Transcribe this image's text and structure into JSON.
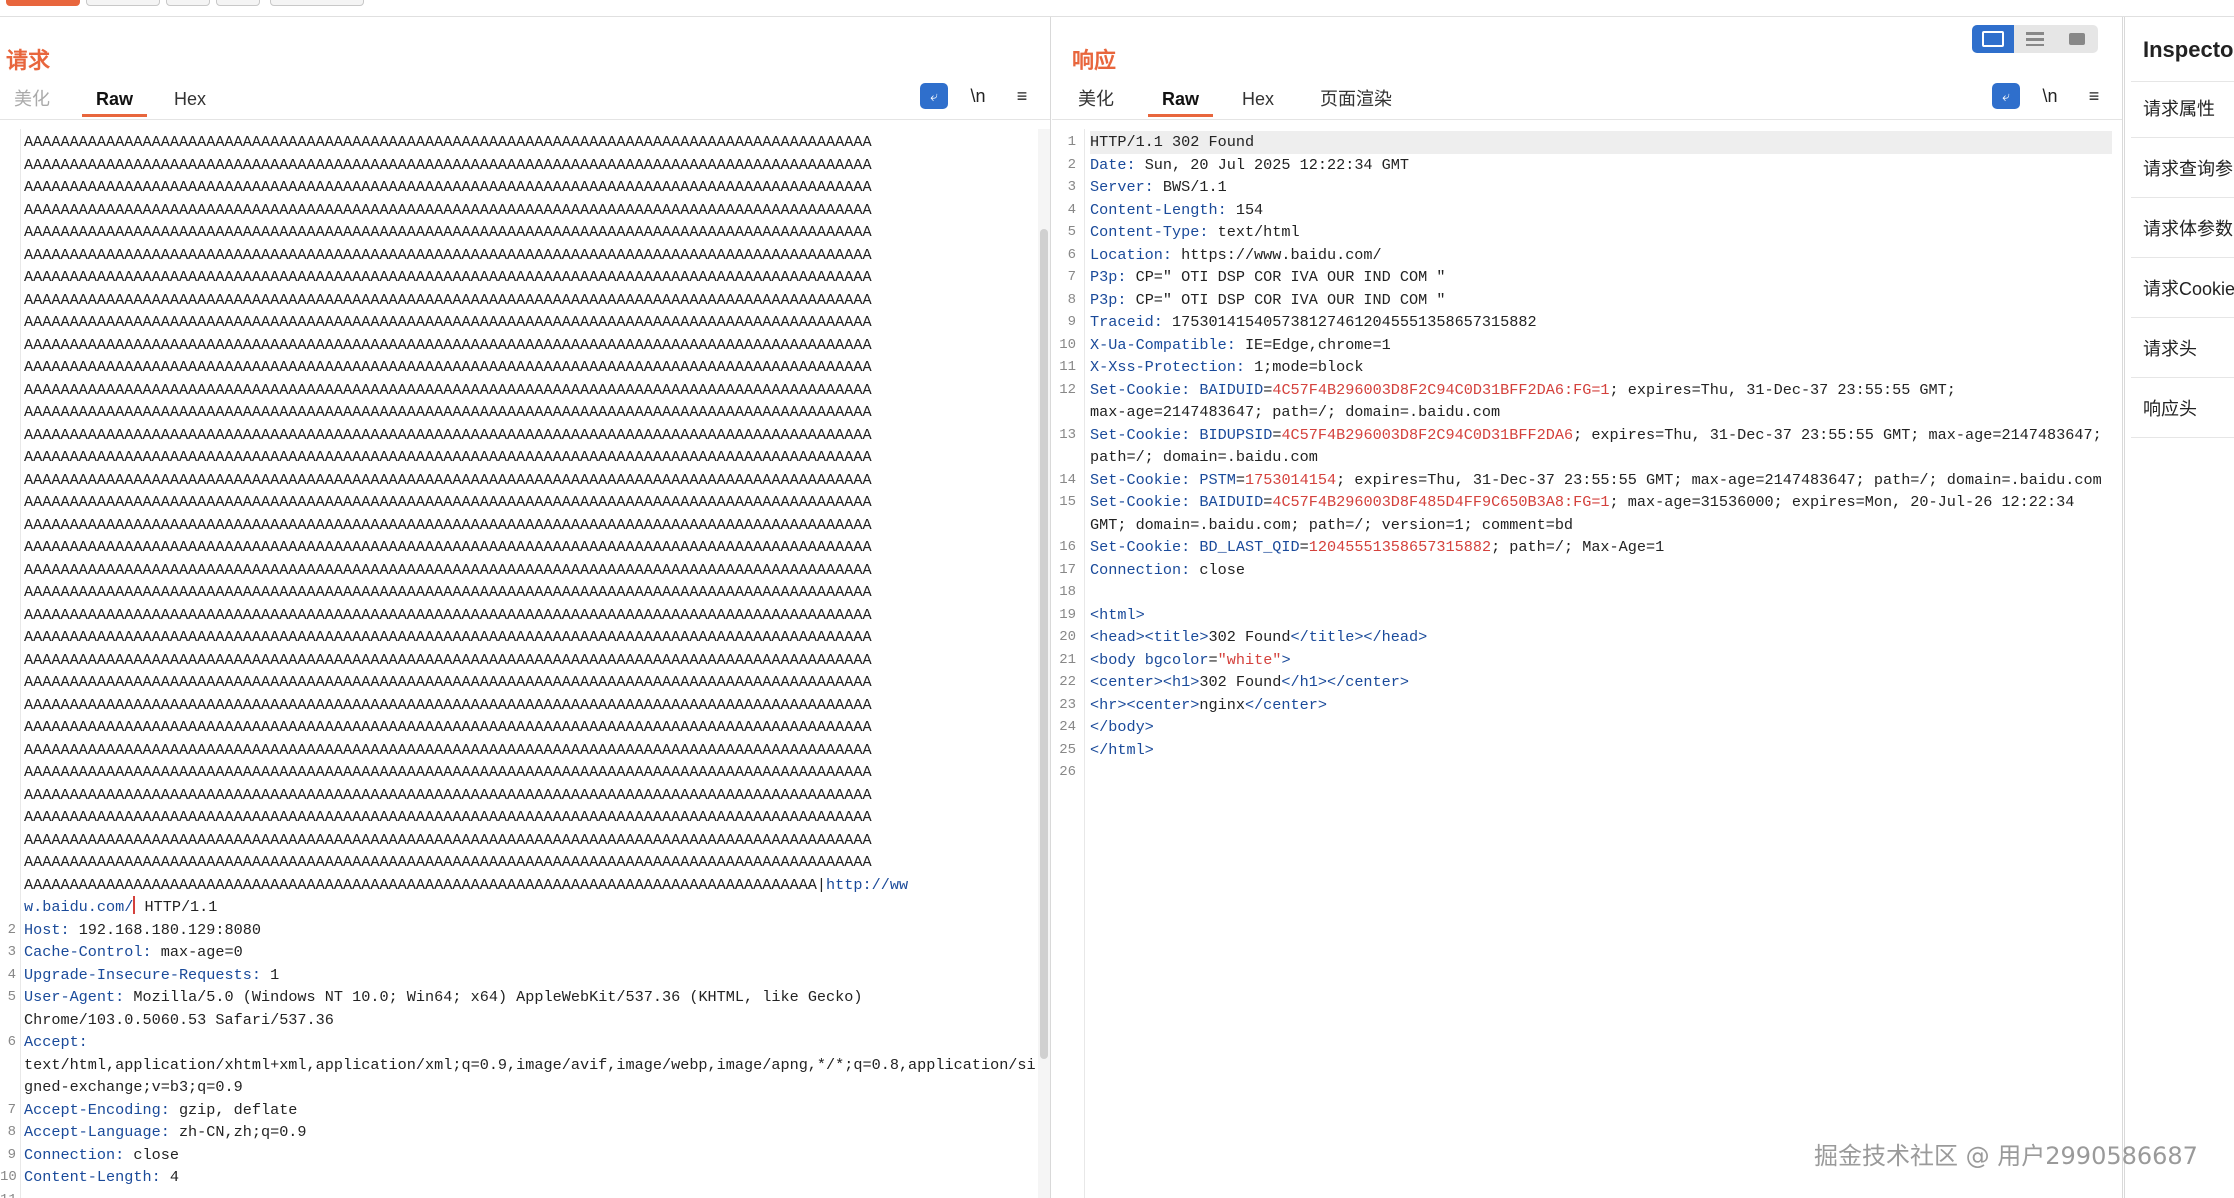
{
  "request": {
    "title": "请求",
    "tabs": [
      "美化",
      "Raw",
      "Hex"
    ],
    "active_tab": "Raw",
    "tools": [
      "\\n",
      "≡"
    ],
    "lines": [
      {
        "n": "",
        "t": "AAAAAAAAAAAAAAAAAAAAAAAAAAAAAAAAAAAAAAAAAAAAAAAAAAAAAAAAAAAAAAAAAAAAAAAAAAAAAAAAAAAAAAAAAAAAA"
      },
      {
        "n": "",
        "t": "AAAAAAAAAAAAAAAAAAAAAAAAAAAAAAAAAAAAAAAAAAAAAAAAAAAAAAAAAAAAAAAAAAAAAAAAAAAAAAAAAAAAAAAAAAAAA"
      },
      {
        "n": "",
        "t": "AAAAAAAAAAAAAAAAAAAAAAAAAAAAAAAAAAAAAAAAAAAAAAAAAAAAAAAAAAAAAAAAAAAAAAAAAAAAAAAAAAAAAAAAAAAAA"
      },
      {
        "n": "",
        "t": "AAAAAAAAAAAAAAAAAAAAAAAAAAAAAAAAAAAAAAAAAAAAAAAAAAAAAAAAAAAAAAAAAAAAAAAAAAAAAAAAAAAAAAAAAAAAA"
      },
      {
        "n": "",
        "t": "AAAAAAAAAAAAAAAAAAAAAAAAAAAAAAAAAAAAAAAAAAAAAAAAAAAAAAAAAAAAAAAAAAAAAAAAAAAAAAAAAAAAAAAAAAAAA"
      },
      {
        "n": "",
        "t": "AAAAAAAAAAAAAAAAAAAAAAAAAAAAAAAAAAAAAAAAAAAAAAAAAAAAAAAAAAAAAAAAAAAAAAAAAAAAAAAAAAAAAAAAAAAAA"
      },
      {
        "n": "",
        "t": "AAAAAAAAAAAAAAAAAAAAAAAAAAAAAAAAAAAAAAAAAAAAAAAAAAAAAAAAAAAAAAAAAAAAAAAAAAAAAAAAAAAAAAAAAAAAA"
      },
      {
        "n": "",
        "t": "AAAAAAAAAAAAAAAAAAAAAAAAAAAAAAAAAAAAAAAAAAAAAAAAAAAAAAAAAAAAAAAAAAAAAAAAAAAAAAAAAAAAAAAAAAAAA"
      },
      {
        "n": "",
        "t": "AAAAAAAAAAAAAAAAAAAAAAAAAAAAAAAAAAAAAAAAAAAAAAAAAAAAAAAAAAAAAAAAAAAAAAAAAAAAAAAAAAAAAAAAAAAAA"
      },
      {
        "n": "",
        "t": "AAAAAAAAAAAAAAAAAAAAAAAAAAAAAAAAAAAAAAAAAAAAAAAAAAAAAAAAAAAAAAAAAAAAAAAAAAAAAAAAAAAAAAAAAAAAA"
      },
      {
        "n": "",
        "t": "AAAAAAAAAAAAAAAAAAAAAAAAAAAAAAAAAAAAAAAAAAAAAAAAAAAAAAAAAAAAAAAAAAAAAAAAAAAAAAAAAAAAAAAAAAAAA"
      },
      {
        "n": "",
        "t": "AAAAAAAAAAAAAAAAAAAAAAAAAAAAAAAAAAAAAAAAAAAAAAAAAAAAAAAAAAAAAAAAAAAAAAAAAAAAAAAAAAAAAAAAAAAAA"
      },
      {
        "n": "",
        "t": "AAAAAAAAAAAAAAAAAAAAAAAAAAAAAAAAAAAAAAAAAAAAAAAAAAAAAAAAAAAAAAAAAAAAAAAAAAAAAAAAAAAAAAAAAAAAA"
      },
      {
        "n": "",
        "t": "AAAAAAAAAAAAAAAAAAAAAAAAAAAAAAAAAAAAAAAAAAAAAAAAAAAAAAAAAAAAAAAAAAAAAAAAAAAAAAAAAAAAAAAAAAAAA"
      },
      {
        "n": "",
        "t": "AAAAAAAAAAAAAAAAAAAAAAAAAAAAAAAAAAAAAAAAAAAAAAAAAAAAAAAAAAAAAAAAAAAAAAAAAAAAAAAAAAAAAAAAAAAAA"
      },
      {
        "n": "",
        "t": "AAAAAAAAAAAAAAAAAAAAAAAAAAAAAAAAAAAAAAAAAAAAAAAAAAAAAAAAAAAAAAAAAAAAAAAAAAAAAAAAAAAAAAAAAAAAA"
      },
      {
        "n": "",
        "t": "AAAAAAAAAAAAAAAAAAAAAAAAAAAAAAAAAAAAAAAAAAAAAAAAAAAAAAAAAAAAAAAAAAAAAAAAAAAAAAAAAAAAAAAAAAAAA"
      },
      {
        "n": "",
        "t": "AAAAAAAAAAAAAAAAAAAAAAAAAAAAAAAAAAAAAAAAAAAAAAAAAAAAAAAAAAAAAAAAAAAAAAAAAAAAAAAAAAAAAAAAAAAAA"
      },
      {
        "n": "",
        "t": "AAAAAAAAAAAAAAAAAAAAAAAAAAAAAAAAAAAAAAAAAAAAAAAAAAAAAAAAAAAAAAAAAAAAAAAAAAAAAAAAAAAAAAAAAAAAA"
      },
      {
        "n": "",
        "t": "AAAAAAAAAAAAAAAAAAAAAAAAAAAAAAAAAAAAAAAAAAAAAAAAAAAAAAAAAAAAAAAAAAAAAAAAAAAAAAAAAAAAAAAAAAAAA"
      },
      {
        "n": "",
        "t": "AAAAAAAAAAAAAAAAAAAAAAAAAAAAAAAAAAAAAAAAAAAAAAAAAAAAAAAAAAAAAAAAAAAAAAAAAAAAAAAAAAAAAAAAAAAAA"
      },
      {
        "n": "",
        "t": "AAAAAAAAAAAAAAAAAAAAAAAAAAAAAAAAAAAAAAAAAAAAAAAAAAAAAAAAAAAAAAAAAAAAAAAAAAAAAAAAAAAAAAAAAAAAA"
      },
      {
        "n": "",
        "t": "AAAAAAAAAAAAAAAAAAAAAAAAAAAAAAAAAAAAAAAAAAAAAAAAAAAAAAAAAAAAAAAAAAAAAAAAAAAAAAAAAAAAAAAAAAAAA"
      },
      {
        "n": "",
        "t": "AAAAAAAAAAAAAAAAAAAAAAAAAAAAAAAAAAAAAAAAAAAAAAAAAAAAAAAAAAAAAAAAAAAAAAAAAAAAAAAAAAAAAAAAAAAAA"
      },
      {
        "n": "",
        "t": "AAAAAAAAAAAAAAAAAAAAAAAAAAAAAAAAAAAAAAAAAAAAAAAAAAAAAAAAAAAAAAAAAAAAAAAAAAAAAAAAAAAAAAAAAAAAA"
      },
      {
        "n": "",
        "t": "AAAAAAAAAAAAAAAAAAAAAAAAAAAAAAAAAAAAAAAAAAAAAAAAAAAAAAAAAAAAAAAAAAAAAAAAAAAAAAAAAAAAAAAAAAAAA"
      },
      {
        "n": "",
        "t": "AAAAAAAAAAAAAAAAAAAAAAAAAAAAAAAAAAAAAAAAAAAAAAAAAAAAAAAAAAAAAAAAAAAAAAAAAAAAAAAAAAAAAAAAAAAAA"
      },
      {
        "n": "",
        "t": "AAAAAAAAAAAAAAAAAAAAAAAAAAAAAAAAAAAAAAAAAAAAAAAAAAAAAAAAAAAAAAAAAAAAAAAAAAAAAAAAAAAAAAAAAAAAA"
      },
      {
        "n": "",
        "t": "AAAAAAAAAAAAAAAAAAAAAAAAAAAAAAAAAAAAAAAAAAAAAAAAAAAAAAAAAAAAAAAAAAAAAAAAAAAAAAAAAAAAAAAAAAAAA"
      },
      {
        "n": "",
        "t": "AAAAAAAAAAAAAAAAAAAAAAAAAAAAAAAAAAAAAAAAAAAAAAAAAAAAAAAAAAAAAAAAAAAAAAAAAAAAAAAAAAAAAAAAAAAAA"
      },
      {
        "n": "",
        "t": "AAAAAAAAAAAAAAAAAAAAAAAAAAAAAAAAAAAAAAAAAAAAAAAAAAAAAAAAAAAAAAAAAAAAAAAAAAAAAAAAAAAAAAAAAAAAA"
      },
      {
        "n": "",
        "t": "AAAAAAAAAAAAAAAAAAAAAAAAAAAAAAAAAAAAAAAAAAAAAAAAAAAAAAAAAAAAAAAAAAAAAAAAAAAAAAAAAAAAAAAAAAAAA"
      },
      {
        "n": "",
        "t": "AAAAAAAAAAAAAAAAAAAAAAAAAAAAAAAAAAAAAAAAAAAAAAAAAAAAAAAAAAAAAAAAAAAAAAAAAAAAAAAAAAAAAAAAAAAAA"
      },
      {
        "n": "",
        "t": "AAAAAAAAAAAAAAAAAAAAAAAAAAAAAAAAAAAAAAAAAAAAAAAAAAAAAAAAAAAAAAAAAAAAAAAAAAAAAAAAAAAAAAA|",
        "tail": "http://ww"
      },
      {
        "n": "",
        "url": "w.baidu.com/",
        "t": " HTTP/1.1",
        "caret": true
      },
      {
        "n": "2",
        "k": "Host",
        "v": " 192.168.180.129:8080"
      },
      {
        "n": "3",
        "k": "Cache-Control",
        "v": " max-age=0"
      },
      {
        "n": "4",
        "k": "Upgrade-Insecure-Requests",
        "v": " 1"
      },
      {
        "n": "5",
        "k": "User-Agent",
        "v": " Mozilla/5.0 (Windows NT 10.0; Win64; x64) AppleWebKit/537.36 (KHTML, like Gecko)"
      },
      {
        "n": "",
        "t": "Chrome/103.0.5060.53 Safari/537.36"
      },
      {
        "n": "6",
        "k": "Accept",
        "v": ""
      },
      {
        "n": "",
        "t": "text/html,application/xhtml+xml,application/xml;q=0.9,image/avif,image/webp,image/apng,*/*;q=0.8,application/si"
      },
      {
        "n": "",
        "t": "gned-exchange;v=b3;q=0.9"
      },
      {
        "n": "7",
        "k": "Accept-Encoding",
        "v": " gzip, deflate"
      },
      {
        "n": "8",
        "k": "Accept-Language",
        "v": " zh-CN,zh;q=0.9"
      },
      {
        "n": "9",
        "k": "Connection",
        "v": " close"
      },
      {
        "n": "10",
        "k": "Content-Length",
        "v": " 4"
      },
      {
        "n": "11",
        "t": ""
      }
    ]
  },
  "response": {
    "title": "响应",
    "tabs": [
      "美化",
      "Raw",
      "Hex",
      "页面渲染"
    ],
    "active_tab": "Raw",
    "tools": [
      "\\n",
      "≡"
    ],
    "lines": [
      {
        "n": "1",
        "t": "HTTP/1.1 302 Found",
        "hl": true
      },
      {
        "n": "2",
        "k": "Date",
        "v": " Sun, 20 Jul 2025 12:22:34 GMT"
      },
      {
        "n": "3",
        "k": "Server",
        "v": " BWS/1.1"
      },
      {
        "n": "4",
        "k": "Content-Length",
        "v": " 154"
      },
      {
        "n": "5",
        "k": "Content-Type",
        "v": " text/html"
      },
      {
        "n": "6",
        "k": "Location",
        "v": " https://www.baidu.com/"
      },
      {
        "n": "7",
        "k": "P3p",
        "v": " CP=\" OTI DSP COR IVA OUR IND COM \""
      },
      {
        "n": "8",
        "k": "P3p",
        "v": " CP=\" OTI DSP COR IVA OUR IND COM \""
      },
      {
        "n": "9",
        "k": "Traceid",
        "v": " 1753014154057381274612045551358657315882"
      },
      {
        "n": "10",
        "k": "X-Ua-Compatible",
        "v": " IE=Edge,chrome=1"
      },
      {
        "n": "11",
        "k": "X-Xss-Protection",
        "v": " 1;mode=block"
      },
      {
        "n": "12",
        "k": "Set-Cookie",
        "ck": "BAIDUID",
        "cv": "4C57F4B296003D8F2C94C0D31BFF2DA6:FG=1",
        "rest": "; expires=Thu, 31-Dec-37 23:55:55 GMT;"
      },
      {
        "n": "",
        "t": "max-age=2147483647; path=/; domain=.baidu.com"
      },
      {
        "n": "13",
        "k": "Set-Cookie",
        "ck": "BIDUPSID",
        "cv": "4C57F4B296003D8F2C94C0D31BFF2DA6",
        "rest": "; expires=Thu, 31-Dec-37 23:55:55 GMT; max-age=2147483647;"
      },
      {
        "n": "",
        "t": "path=/; domain=.baidu.com"
      },
      {
        "n": "14",
        "k": "Set-Cookie",
        "ck": "PSTM",
        "cv": "1753014154",
        "rest": "; expires=Thu, 31-Dec-37 23:55:55 GMT; max-age=2147483647; path=/; domain=.baidu.com"
      },
      {
        "n": "15",
        "k": "Set-Cookie",
        "ck": "BAIDUID",
        "cv": "4C57F4B296003D8F485D4FF9C650B3A8:FG=1",
        "rest": "; max-age=31536000; expires=Mon, 20-Jul-26 12:22:34"
      },
      {
        "n": "",
        "t": "GMT; domain=.baidu.com; path=/; version=1; comment=bd"
      },
      {
        "n": "16",
        "k": "Set-Cookie",
        "ck": "BD_LAST_QID",
        "cv": "12045551358657315882",
        "rest": "; path=/; Max-Age=1"
      },
      {
        "n": "17",
        "k": "Connection",
        "v": " close"
      },
      {
        "n": "18",
        "t": ""
      },
      {
        "n": "19",
        "html": [
          [
            "tag",
            "<html>"
          ]
        ]
      },
      {
        "n": "20",
        "html": [
          [
            "tag",
            "<head><title>"
          ],
          [
            "txt",
            "302 Found"
          ],
          [
            "tag",
            "</title></head>"
          ]
        ]
      },
      {
        "n": "21",
        "html": [
          [
            "tag",
            "<body "
          ],
          [
            "attr",
            "bgcolor"
          ],
          [
            "txt",
            "="
          ],
          [
            "sval",
            "\"white\""
          ],
          [
            "tag",
            ">"
          ]
        ]
      },
      {
        "n": "22",
        "html": [
          [
            "tag",
            "<center><h1>"
          ],
          [
            "txt",
            "302 Found"
          ],
          [
            "tag",
            "</h1></center>"
          ]
        ]
      },
      {
        "n": "23",
        "html": [
          [
            "tag",
            "<hr><center>"
          ],
          [
            "txt",
            "nginx"
          ],
          [
            "tag",
            "</center>"
          ]
        ]
      },
      {
        "n": "24",
        "html": [
          [
            "tag",
            "</body>"
          ]
        ]
      },
      {
        "n": "25",
        "html": [
          [
            "tag",
            "</html>"
          ]
        ]
      },
      {
        "n": "26",
        "t": ""
      }
    ]
  },
  "inspector": {
    "title": "Inspecto",
    "items": [
      "请求属性",
      "请求查询参",
      "请求体参数",
      "请求Cookie",
      "请求头",
      "响应头"
    ]
  },
  "watermark": "掘金技术社区 @ 用户2990586687",
  "colors": {
    "accent": "#e8663d",
    "key": "#1a4a9a",
    "value": "#d4413c",
    "toolbar_blue": "#2f6fcc"
  }
}
